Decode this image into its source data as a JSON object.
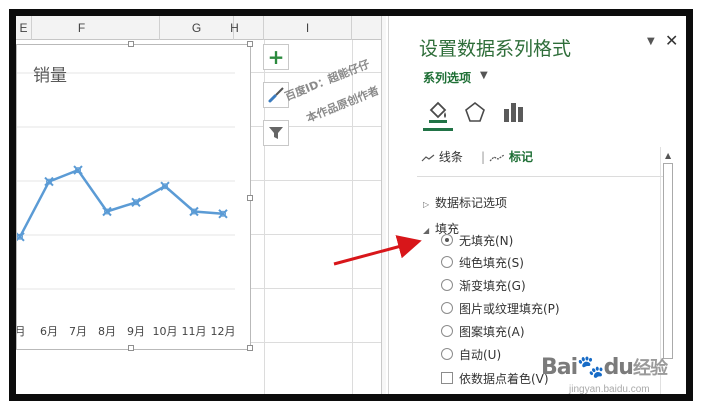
{
  "sheet": {
    "columns": [
      "E",
      "F",
      "G",
      "H",
      "I"
    ]
  },
  "chart": {
    "title": "销量",
    "side_buttons": [
      "add-chart-element",
      "chart-styles",
      "chart-filters"
    ]
  },
  "chart_data": {
    "type": "line",
    "title": "销量",
    "categories": [
      "月",
      "6月",
      "7月",
      "8月",
      "9月",
      "10月",
      "11月",
      "12月"
    ],
    "series": [
      {
        "values": [
          34,
          58,
          63,
          45,
          49,
          56,
          45,
          44
        ]
      }
    ],
    "marker": "x-cross",
    "line_color": "#5b9bd5",
    "grid": true
  },
  "watermark": {
    "line1": "百度ID：超能仔仔",
    "line2": "本作品原创作者"
  },
  "pane": {
    "title": "设置数据系列格式",
    "series_options_label": "系列选项",
    "icons": [
      "fill-line-icon",
      "effects-pentagon-icon",
      "series-options-bar-icon"
    ],
    "tabs": {
      "line": "线条",
      "marker": "标记"
    },
    "sections": {
      "marker_options": "数据标记选项",
      "fill": "填充"
    },
    "fill_options": [
      {
        "label": "无填充(N)",
        "selected": true
      },
      {
        "label": "纯色填充(S)",
        "selected": false
      },
      {
        "label": "渐变填充(G)",
        "selected": false
      },
      {
        "label": "图片或纹理填充(P)",
        "selected": false
      },
      {
        "label": "图案填充(A)",
        "selected": false
      },
      {
        "label": "自动(U)",
        "selected": false
      }
    ],
    "vary_colors_label": "依数据点着色(V)"
  },
  "baidu": {
    "logo_text": "Bai",
    "logo_paw": "du",
    "logo_suffix": "经验",
    "url": "jingyan.baidu.com"
  },
  "colors": {
    "accent": "#217346",
    "pane_title": "#2f6e3a",
    "series_line": "#5b9bd5",
    "annotation_arrow": "#d8161a"
  }
}
